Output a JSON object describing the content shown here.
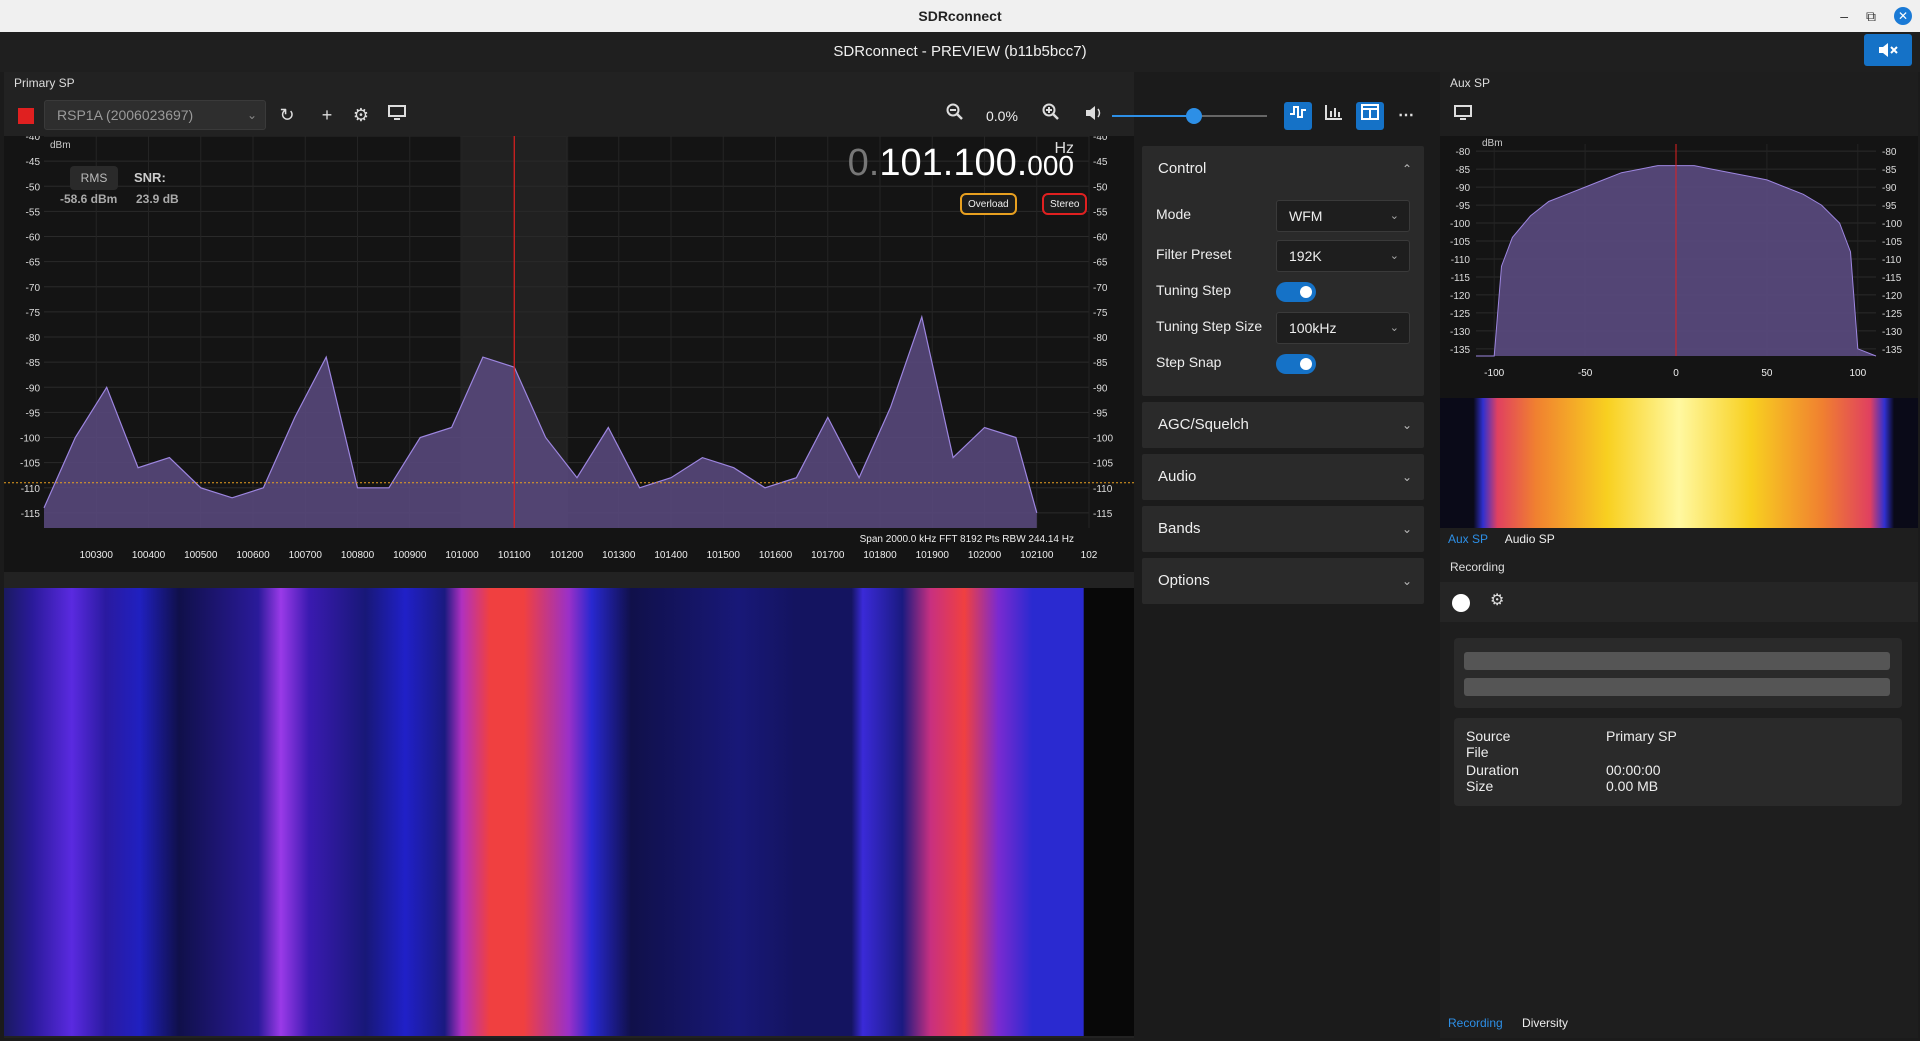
{
  "window": {
    "title": "SDRconnect",
    "app_title": "SDRconnect - PREVIEW (b11b5bcc7)",
    "controls": [
      "–",
      "⧉",
      "✕"
    ]
  },
  "primary": {
    "label": "Primary SP",
    "device": "RSP1A (2006023697)",
    "zoom": "0.0%",
    "volume_level": 0.53,
    "icons": [
      "stop-icon",
      "refresh-icon",
      "add-icon",
      "settings-icon",
      "monitor-icon",
      "zoom-out-icon",
      "zoom-in-icon",
      "volume-icon",
      "spectrum-mode-icon",
      "bars-icon",
      "layout-icon",
      "more-icon"
    ]
  },
  "spectrum": {
    "freq_dim": "0.",
    "freq_main": "101.100.",
    "freq_small": "000",
    "unit": "Hz",
    "dbm_unit": "dBm",
    "rms_label": "RMS",
    "snr_label": "SNR:",
    "rms_value": "-58.6 dBm",
    "snr_value": "23.9 dB",
    "overload": "Overload",
    "stereo": "Stereo",
    "span_info": "Span 2000.0 kHz FFT 8192 Pts  RBW 244.14 Hz"
  },
  "chart_data": [
    {
      "type": "line",
      "xlabel": "",
      "ylabel": "dBm",
      "ylim": [
        -118,
        -40
      ],
      "y_ticks": [
        -40,
        -45,
        -50,
        -55,
        -60,
        -65,
        -70,
        -75,
        -80,
        -85,
        -90,
        -95,
        -100,
        -105,
        -110,
        -115
      ],
      "x_ticks": [
        "100300",
        "100400",
        "100500",
        "100600",
        "100700",
        "100800",
        "100900",
        "101000",
        "101100",
        "101200",
        "101300",
        "101400",
        "101500",
        "101600",
        "101700",
        "101800",
        "101900",
        "102000",
        "102100",
        "102"
      ],
      "x": [
        100200,
        100260,
        100320,
        100380,
        100440,
        100500,
        100560,
        100620,
        100680,
        100740,
        100800,
        100860,
        100920,
        100980,
        101040,
        101100,
        101160,
        101220,
        101280,
        101340,
        101400,
        101460,
        101520,
        101580,
        101640,
        101700,
        101760,
        101820,
        101880,
        101940,
        102000,
        102060,
        102100
      ],
      "series": [
        {
          "values": [
            -114,
            -100,
            -90,
            -106,
            -104,
            -110,
            -112,
            -110,
            -96,
            -84,
            -110,
            -110,
            -100,
            -98,
            -84,
            -86,
            -100,
            -108,
            -98,
            -110,
            -108,
            -104,
            -106,
            -110,
            -108,
            -96,
            -108,
            -94,
            -76,
            -104,
            -98,
            -100,
            -115
          ]
        }
      ],
      "center_freq": 101100,
      "squelch_level": -109
    },
    {
      "type": "area",
      "ylabel": "dBm",
      "ylim": [
        -137,
        -78
      ],
      "y_ticks": [
        -80,
        -85,
        -90,
        -95,
        -100,
        -105,
        -110,
        -115,
        -120,
        -125,
        -130,
        -135
      ],
      "x_ticks": [
        "-100",
        "-50",
        "0",
        "50",
        "100"
      ],
      "xlim": [
        -110,
        110
      ],
      "x": [
        -110,
        -100,
        -96,
        -90,
        -80,
        -70,
        -60,
        -50,
        -40,
        -30,
        -20,
        -10,
        0,
        10,
        20,
        30,
        40,
        50,
        60,
        70,
        80,
        90,
        96,
        100,
        110
      ],
      "series": [
        {
          "values": [
            -137,
            -137,
            -112,
            -104,
            -98,
            -94,
            -92,
            -90,
            -88,
            -86,
            -85,
            -84,
            -84,
            -84,
            -85,
            -86,
            -87,
            -88,
            -90,
            -92,
            -95,
            -100,
            -108,
            -135,
            -137
          ]
        }
      ]
    }
  ],
  "controls": {
    "control_section": "Control",
    "mode_label": "Mode",
    "mode_value": "WFM",
    "filter_label": "Filter Preset",
    "filter_value": "192K",
    "tuning_step_label": "Tuning Step",
    "tuning_step_size_label": "Tuning Step Size",
    "tuning_step_size_value": "100kHz",
    "step_snap_label": "Step Snap",
    "agc": "AGC/Squelch",
    "audio": "Audio",
    "bands": "Bands",
    "options": "Options"
  },
  "aux": {
    "label": "Aux SP",
    "dbm_unit": "dBm",
    "tab_aux": "Aux SP",
    "tab_audio": "Audio SP",
    "recording_label": "Recording",
    "source_label": "Source",
    "source_value": "Primary SP",
    "file_label": "File",
    "duration_label": "Duration",
    "duration_value": "00:00:00",
    "size_label": "Size",
    "size_value": "0.00 MB",
    "bottom_recording": "Recording",
    "bottom_diversity": "Diversity"
  },
  "colors": {
    "accent": "#1572c7",
    "spectrum_fill": "#5a4a80",
    "spectrum_line": "#9d86e0",
    "tuning_line": "#e02020",
    "squelch": "#e8a020"
  }
}
